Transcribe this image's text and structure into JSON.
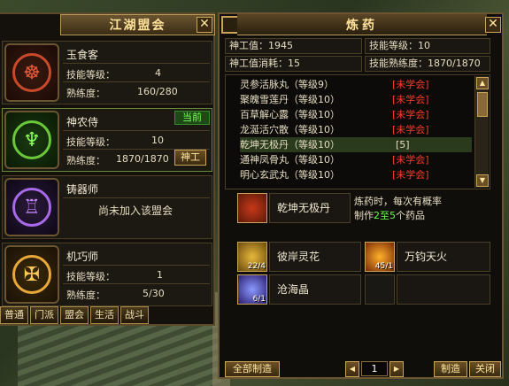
{
  "guild_panel": {
    "title": "江湖盟会",
    "close_label": "✕",
    "guilds": [
      {
        "name": "玉食客",
        "skill_label": "技能等级：",
        "skill": "4",
        "prof_label": "熟练度：",
        "prof": "160/280"
      },
      {
        "name": "神农侍",
        "skill_label": "技能等级：",
        "skill": "10",
        "prof_label": "熟练度：",
        "prof": "1870/1870",
        "badge": "当前",
        "button": "神工"
      },
      {
        "name": "铸器师",
        "note": "尚未加入该盟会"
      },
      {
        "name": "机巧师",
        "skill_label": "技能等级：",
        "skill": "1",
        "prof_label": "熟练度：",
        "prof": "5/30"
      }
    ],
    "tabs": [
      "普通",
      "门派",
      "盟会",
      "生活",
      "战斗"
    ]
  },
  "alchemy_panel": {
    "title": "炼药",
    "close_label": "✕",
    "stats": {
      "shengong": "神工值：1945",
      "skill": "技能等级：10",
      "consume": "神工值消耗：15",
      "prof": "技能熟练度：1870/1870"
    },
    "recipes": [
      {
        "name": "灵参活脉丸（等级9）",
        "status": "[未学会]"
      },
      {
        "name": "聚魄雪莲丹（等级10）",
        "status": "[未学会]"
      },
      {
        "name": "百草解心露（等级10）",
        "status": "[未学会]"
      },
      {
        "name": "龙涎活穴散（等级10）",
        "status": "[未学会]"
      },
      {
        "name": "乾坤无极丹（等级10）",
        "status": "[5]"
      },
      {
        "name": "通神凤骨丸（等级10）",
        "status": "[未学会]"
      },
      {
        "name": "明心玄武丸（等级10）",
        "status": "[未学会]"
      }
    ],
    "selected": {
      "name": "乾坤无极丹"
    },
    "description": {
      "line1": "炼药时，每次有概率",
      "line2_pre": "制作",
      "line2_hl": "2至5",
      "line2_post": "个药品"
    },
    "materials": [
      {
        "name": "彼岸灵花",
        "count": "22/4"
      },
      {
        "name": "万钧天火",
        "count": "45/1"
      },
      {
        "name": "沧海晶",
        "count": "6/1"
      }
    ],
    "bottom": {
      "make_all": "全部制造",
      "quantity": "1",
      "make": "制造",
      "close": "关闭"
    }
  }
}
